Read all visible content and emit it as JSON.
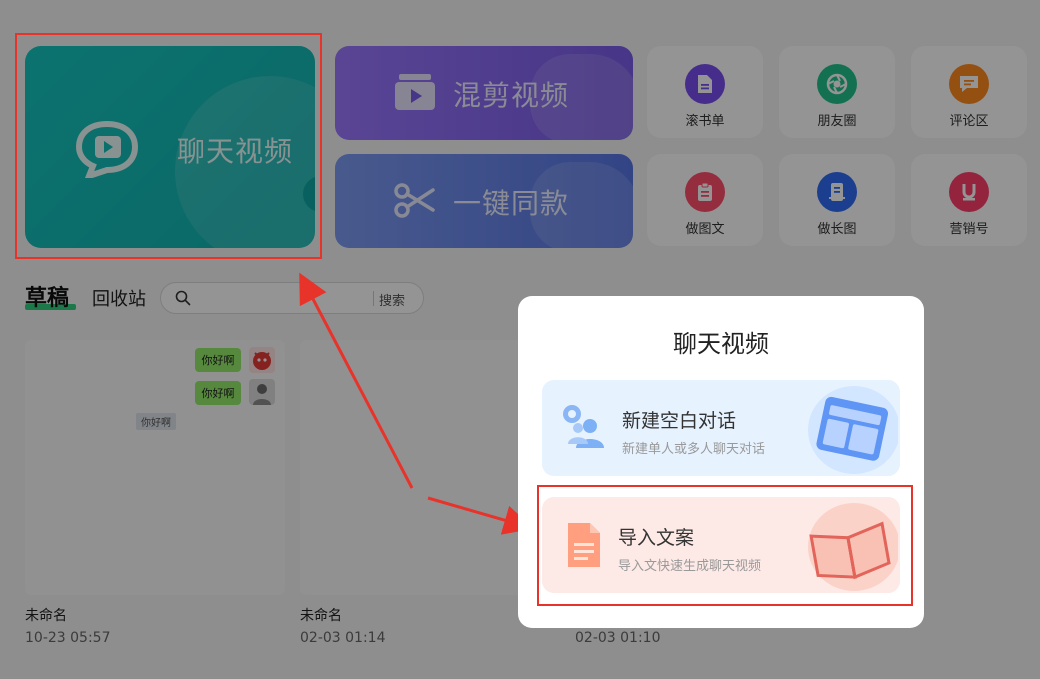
{
  "cards": {
    "chat_video": "聊天视频",
    "mix_video": "混剪视频",
    "one_click_same": "一键同款"
  },
  "tiles": [
    {
      "label": "滚书单",
      "color": "#7a4ff0",
      "icon": "document-icon"
    },
    {
      "label": "朋友圈",
      "color": "#22c38e",
      "icon": "aperture-icon"
    },
    {
      "label": "评论区",
      "color": "#ff8a1e",
      "icon": "comment-icon"
    },
    {
      "label": "做图文",
      "color": "#ff4f6c",
      "icon": "clipboard-icon"
    },
    {
      "label": "做长图",
      "color": "#2f6cf5",
      "icon": "long-image-icon"
    },
    {
      "label": "营销号",
      "color": "#ff3e6c",
      "icon": "u-letter-icon"
    }
  ],
  "tabs": {
    "draft": "草稿",
    "trash": "回收站"
  },
  "search": {
    "placeholder": "",
    "button": "搜索"
  },
  "drafts": [
    {
      "name": "未命名",
      "time": "10-23 05:57",
      "bubble1": "你好啊",
      "bubble2": "你好啊",
      "center": "你好啊"
    },
    {
      "name": "未命名",
      "time": "02-03 01:14"
    },
    {
      "name": "",
      "time": "02-03 01:10"
    }
  ],
  "modal": {
    "title": "聊天视频",
    "options": [
      {
        "title": "新建空白对话",
        "desc": "新建单人或多人聊天对话"
      },
      {
        "title": "导入文案",
        "desc": "导入文快速生成聊天视频"
      }
    ]
  },
  "colors": {
    "annotation_red": "#e8332b",
    "chat_card": "#14bfbb",
    "accent_green": "#2fd07f"
  }
}
